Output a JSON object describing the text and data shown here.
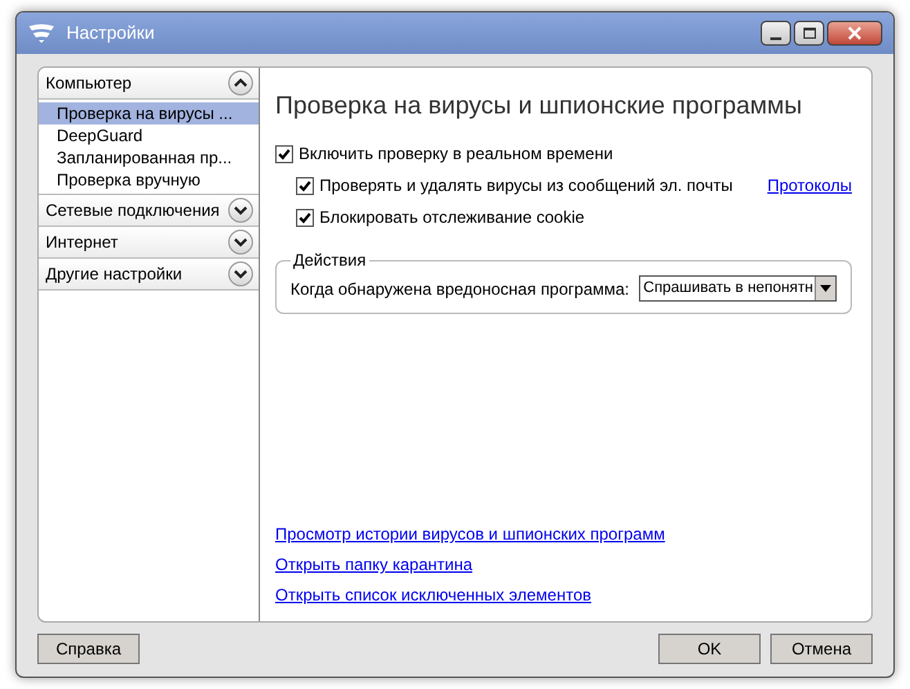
{
  "window": {
    "title": "Настройки"
  },
  "sidebar": {
    "sections": [
      {
        "title": "Компьютер",
        "expanded": true,
        "items": [
          {
            "label": "Проверка на вирусы ...",
            "selected": true
          },
          {
            "label": "DeepGuard",
            "selected": false
          },
          {
            "label": "Запланированная пр...",
            "selected": false
          },
          {
            "label": "Проверка вручную",
            "selected": false
          }
        ]
      },
      {
        "title": "Сетевые подключения",
        "expanded": false
      },
      {
        "title": "Интернет",
        "expanded": false
      },
      {
        "title": "Другие настройки",
        "expanded": false
      }
    ]
  },
  "content": {
    "heading": "Проверка на вирусы и шпионские программы",
    "options": [
      {
        "label": "Включить проверку в реальном времени",
        "checked": true,
        "indented": false
      },
      {
        "label": "Проверять и удалять вирусы из сообщений эл. почты",
        "checked": true,
        "indented": true,
        "link": "Протоколы"
      },
      {
        "label": "Блокировать отслеживание cookie",
        "checked": true,
        "indented": true
      }
    ],
    "actions": {
      "legend": "Действия",
      "label": "Когда обнаружена вредоносная программа:",
      "value": "Спрашивать в непонятн"
    },
    "links": [
      "Просмотр истории вирусов и шпионских программ",
      "Открыть папку карантина",
      "Открыть список исключенных элементов"
    ]
  },
  "buttons": {
    "help": "Справка",
    "ok": "OK",
    "cancel": "Отмена"
  }
}
